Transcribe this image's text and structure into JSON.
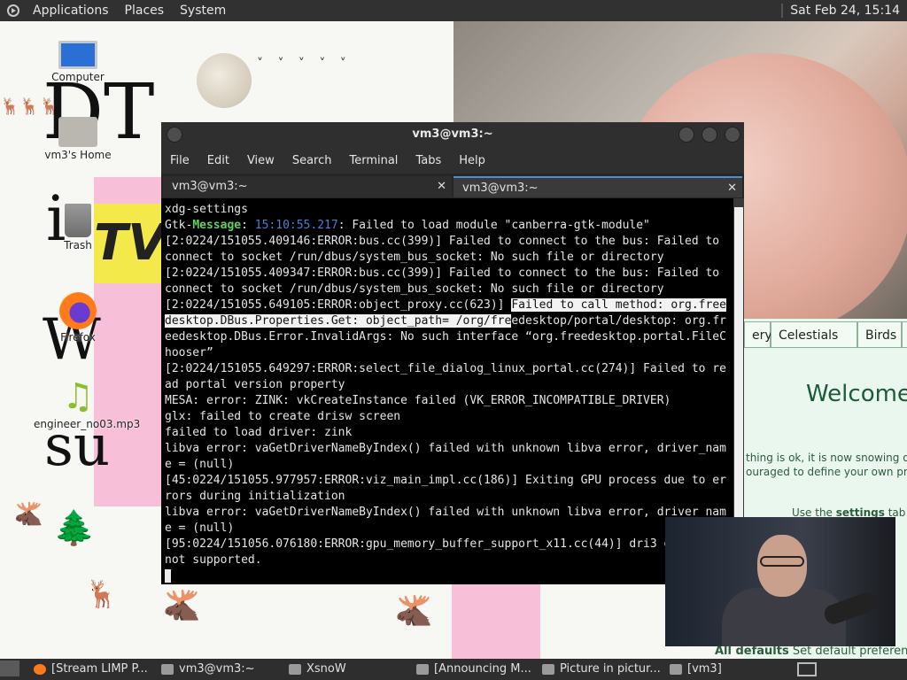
{
  "top_panel": {
    "applications": "Applications",
    "places": "Places",
    "system": "System",
    "clock": "Sat Feb 24, 15:14"
  },
  "desktop": {
    "icons": [
      {
        "label": "Computer"
      },
      {
        "label": "vm3's Home"
      },
      {
        "label": "Trash"
      },
      {
        "label": "Firefox"
      },
      {
        "label": "engineer_no03.mp3"
      }
    ],
    "letters": [
      "DT",
      "i",
      "W",
      "su"
    ],
    "pink_word": "TV"
  },
  "terminal": {
    "title": "vm3@vm3:~",
    "menu": [
      "File",
      "Edit",
      "View",
      "Search",
      "Terminal",
      "Tabs",
      "Help"
    ],
    "tabs": [
      {
        "label": "vm3@vm3:~"
      },
      {
        "label": "vm3@vm3:~"
      }
    ],
    "lines": {
      "l1": "xdg-settings",
      "l2a": "Gtk-",
      "l2b": "Message",
      "l2c": ": ",
      "l2d": "15:10:55.217",
      "l2e": ": Failed to load module \"canberra-gtk-module\"",
      "l3": "[2:0224/151055.409146:ERROR:bus.cc(399)] Failed to connect to the bus: Failed to connect to socket /run/dbus/system_bus_socket: No such file or directory",
      "l4": "[2:0224/151055.409347:ERROR:bus.cc(399)] Failed to connect to the bus: Failed to connect to socket /run/dbus/system_bus_socket: No such file or directory",
      "l5a": "[2:0224/151055.649105:ERROR:object_proxy.cc(623)] ",
      "l5b": "Failed to call method: org.freedesktop.DBus.Properties.Get: object_path= /org/fre",
      "l5c": "edesktop/portal/desktop: org.freedesktop.DBus.Error.InvalidArgs: No such interface “org.freedesktop.portal.FileChooser”",
      "l6": "[2:0224/151055.649297:ERROR:select_file_dialog_linux_portal.cc(274)] Failed to read portal version property",
      "l7": "MESA: error: ZINK: vkCreateInstance failed (VK_ERROR_INCOMPATIBLE_DRIVER)",
      "l8": "glx: failed to create drisw screen",
      "l9": "failed to load driver: zink",
      "l10": "libva error: vaGetDriverNameByIndex() failed with unknown libva error, driver_name = (null)",
      "l11": "[45:0224/151055.977957:ERROR:viz_main_impl.cc(186)] Exiting GPU process due to errors during initialization",
      "l12": "libva error: vaGetDriverNameByIndex() failed with unknown libva error, driver_name = (null)",
      "l13": "[95:0224/151056.076180:ERROR:gpu_memory_buffer_support_x11.cc(44)] dri3 extension not supported."
    }
  },
  "browser": {
    "tabs": [
      "ery",
      "Celestials",
      "Birds",
      "Se"
    ],
    "welcome": "Welcome",
    "line1": "thing is ok, it is now snowing or",
    "line2": "ouraged to define your own pre",
    "line3a": "Use the ",
    "line3b": "settings",
    "line3c": " tab if",
    "footer_a": "All defaults",
    "footer_b": "Set default preferences"
  },
  "taskbar": {
    "items": [
      {
        "label": "[Stream LIMP P..."
      },
      {
        "label": "vm3@vm3:~"
      },
      {
        "label": "XsnoW"
      },
      {
        "label": "[Announcing M..."
      },
      {
        "label": "Picture in pictur..."
      },
      {
        "label": "[vm3]"
      }
    ]
  },
  "colors": {
    "panel": "#313131",
    "terminal_bg": "#000000",
    "gtk_message_green": "#5fd35f",
    "timestamp_blue": "#4f7fd0",
    "browser_green": "#1d5a3a"
  }
}
